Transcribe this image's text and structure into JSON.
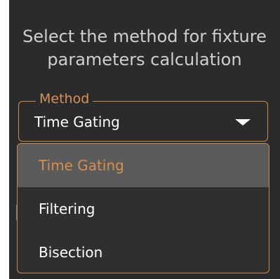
{
  "prompt": {
    "line1": "Select the method for fixture",
    "line2": "parameters calculation"
  },
  "method_field": {
    "legend": "Method",
    "selected": "Time Gating",
    "caret_icon": "caret-down-icon"
  },
  "dropdown": {
    "options": [
      {
        "label": "Time Gating",
        "active": true
      },
      {
        "label": "Filtering",
        "active": false
      },
      {
        "label": "Bisection",
        "active": false
      }
    ]
  },
  "colors": {
    "panel_bg": "#2b2b2b",
    "accent": "#d48e50",
    "highlight_bg": "#5b5b5b",
    "text": "#ffffff"
  }
}
